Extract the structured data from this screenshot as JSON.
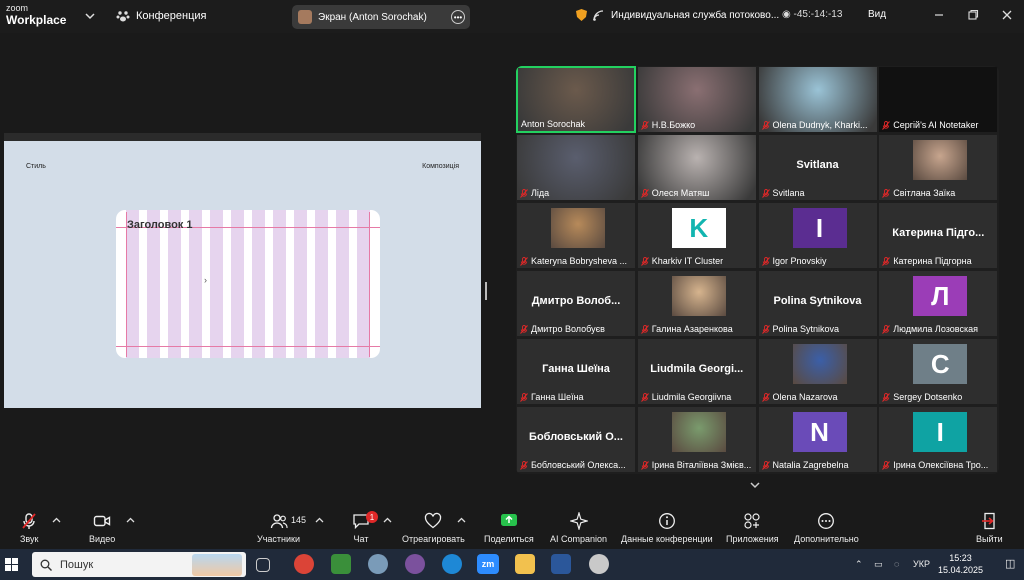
{
  "app": {
    "brand_top": "zoom",
    "brand_bottom": "Workplace"
  },
  "header": {
    "meeting_label": "Конференция",
    "share_label": "Экран (Anton Sorochak)",
    "service_label": "Индивидуальная служба потоково...",
    "timer": "-45:-14:-13",
    "view_label": "Вид"
  },
  "shared_screen": {
    "left_label": "Стиль",
    "right_label": "Композиція",
    "heading": "Заголовок 1",
    "cursor": "›"
  },
  "participants": [
    {
      "name": "Anton Sorochak",
      "kind": "photo",
      "color": "#6b5a4c",
      "muted": false,
      "active": true
    },
    {
      "name": "Н.В.Божко",
      "kind": "photo",
      "color": "#8a6f72",
      "muted": true
    },
    {
      "name": "Olena Dudnyk, Kharki...",
      "kind": "photo",
      "color": "#9ac3d6",
      "muted": true
    },
    {
      "name": "Сергій's AI Notetaker",
      "kind": "dark",
      "color": "#111111",
      "muted": true
    },
    {
      "name": "Ліда",
      "kind": "photo",
      "color": "#5a5e6e",
      "muted": true
    },
    {
      "name": "Олеся Матяш",
      "kind": "photo",
      "color": "#b9b2b0",
      "muted": true
    },
    {
      "name": "Svitlana",
      "kind": "text",
      "display": "Svitlana",
      "muted": true
    },
    {
      "name": "Світлана Заїка",
      "kind": "avatar-photo",
      "color": "#c7a58e",
      "muted": true
    },
    {
      "name": "Kateryna Bobrysheva ...",
      "kind": "avatar-photo",
      "color": "#b78a5a",
      "muted": true
    },
    {
      "name": "Kharkiv IT Cluster",
      "kind": "logo",
      "color": "#12b5b0",
      "letter": "K",
      "muted": true
    },
    {
      "name": "Igor Pnovskiy",
      "kind": "letter",
      "color": "#5b2d91",
      "letter": "I",
      "muted": true
    },
    {
      "name": "Катерина Підгорна",
      "kind": "text",
      "display": "Катерина Підго...",
      "muted": true
    },
    {
      "name": "Дмитро Волобуєв",
      "kind": "text",
      "display": "Дмитро Волоб...",
      "muted": true
    },
    {
      "name": "Галина Азаренкова",
      "kind": "avatar-photo",
      "color": "#d6b48e",
      "muted": true
    },
    {
      "name": "Polina Sytnikova",
      "kind": "text",
      "display": "Polina Sytnikova",
      "muted": true
    },
    {
      "name": "Людмила Лозовская",
      "kind": "letter",
      "color": "#9b3db7",
      "letter": "Л",
      "muted": true
    },
    {
      "name": "Ганна Шеїна",
      "kind": "text",
      "display": "Ганна Шеїна",
      "muted": true
    },
    {
      "name": "Liudmila Georgiivna",
      "kind": "text",
      "display": "Liudmila Georgi...",
      "muted": true
    },
    {
      "name": "Olena Nazarova",
      "kind": "avatar-photo",
      "color": "#3b5fa8",
      "muted": true
    },
    {
      "name": "Sergey Dotsenko",
      "kind": "letter",
      "color": "#6f7f88",
      "letter": "C",
      "muted": true
    },
    {
      "name": "Бобловський Олекса...",
      "kind": "text",
      "display": "Бобловський О...",
      "muted": true
    },
    {
      "name": "Ірина Віталіївна Змієв...",
      "kind": "avatar-photo",
      "color": "#7a9b6d",
      "muted": true
    },
    {
      "name": "Natalia Zagrebelna",
      "kind": "letter",
      "color": "#6a4bb8",
      "letter": "N",
      "muted": true
    },
    {
      "name": "Ірина Олексіївна Тро...",
      "kind": "letter",
      "color": "#0fa3a3",
      "letter": "I",
      "muted": true
    }
  ],
  "toolbar": {
    "audio": "Звук",
    "video": "Видео",
    "participants": "Участники",
    "participants_count": "145",
    "chat": "Чат",
    "chat_badge": "1",
    "react": "Отреагировать",
    "share": "Поделиться",
    "ai": "AI Companion",
    "info": "Данные конференции",
    "apps": "Приложения",
    "more": "Дополнительно",
    "leave": "Выйти"
  },
  "taskbar": {
    "search_placeholder": "Пошук",
    "lang": "УКР",
    "time": "15:23",
    "date": "15.04.2025"
  },
  "colors": {
    "accent_green": "#23d160",
    "share_green": "#27c24c",
    "badge_red": "#e02828"
  }
}
